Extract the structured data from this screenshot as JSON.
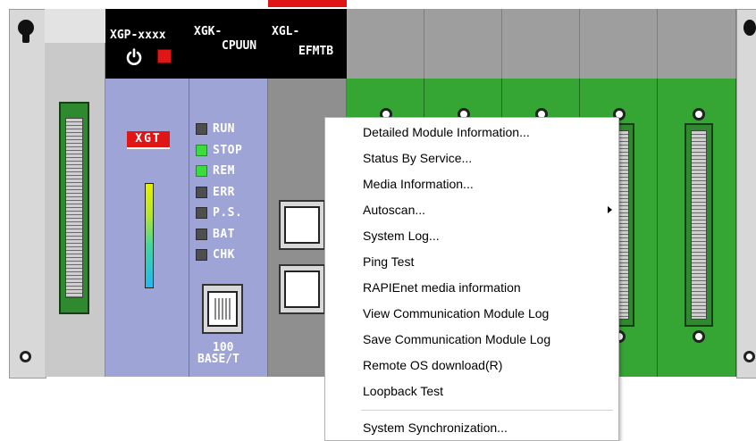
{
  "modules": {
    "power": {
      "name": "XGP-xxxx"
    },
    "cpu": {
      "name_line1": "XGK-",
      "name_line2": "CPUUN",
      "logo": "XGT"
    },
    "ethernet": {
      "name_line1": "XGL-",
      "name_line2": "EFMTB",
      "port_label_line1": "100",
      "port_label_line2": "BASE/T"
    }
  },
  "status_leds": [
    {
      "label": "RUN",
      "state": "off"
    },
    {
      "label": "STOP",
      "state": "on"
    },
    {
      "label": "REM",
      "state": "on"
    },
    {
      "label": "ERR",
      "state": "off"
    },
    {
      "label": "P.S.",
      "state": "off"
    },
    {
      "label": "BAT",
      "state": "off"
    },
    {
      "label": "CHK",
      "state": "off"
    }
  ],
  "context_menu": {
    "items": [
      {
        "label": "Detailed Module Information..."
      },
      {
        "label": "Status By Service..."
      },
      {
        "label": "Media Information..."
      },
      {
        "label": "Autoscan...",
        "has_submenu": true
      },
      {
        "label": "System Log..."
      },
      {
        "label": "Ping Test"
      },
      {
        "label": "RAPIEnet media information"
      },
      {
        "label": "View Communication Module Log"
      },
      {
        "label": "Save Communication Module Log"
      },
      {
        "label": "Remote OS download(R)"
      },
      {
        "label": "Loopback Test"
      },
      {
        "label": "System Synchronization..."
      }
    ]
  },
  "colors": {
    "io_module_green": "#35a534",
    "cpu_panel_lavender": "#9ea4d6",
    "power_led_red": "#e01515",
    "logo_red": "#e01515"
  }
}
